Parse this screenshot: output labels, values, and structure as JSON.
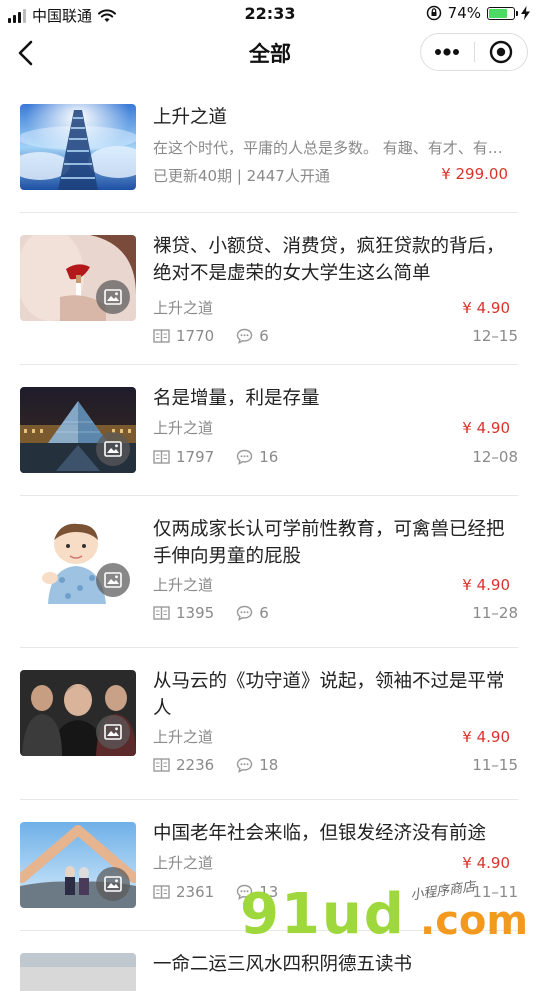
{
  "status_bar": {
    "carrier": "中国联通",
    "time": "22:33",
    "battery": "74%",
    "battery_level": 0.74
  },
  "nav": {
    "title": "全部",
    "more_icon": "more-dots-icon",
    "close_icon": "target-circle-icon"
  },
  "featured": {
    "title": "上升之道",
    "description": "在这个时代，平庸的人总是多数。 有趣、有才、有…",
    "meta": "已更新40期 | 2447人开通",
    "price": "¥ 299.00"
  },
  "articles": [
    {
      "title": "裸贷、小额贷、消费贷，疯狂贷款的背后，绝对不是虚荣的女大学生这么简单",
      "column": "上升之道",
      "price": "¥ 4.90",
      "reads": "1770",
      "comments": "6",
      "date": "12–15"
    },
    {
      "title": "名是增量，利是存量",
      "column": "上升之道",
      "price": "¥ 4.90",
      "reads": "1797",
      "comments": "16",
      "date": "12–08"
    },
    {
      "title": "仅两成家长认可学前性教育，可禽兽已经把手伸向男童的屁股",
      "column": "上升之道",
      "price": "¥ 4.90",
      "reads": "1395",
      "comments": "6",
      "date": "11–28"
    },
    {
      "title": "从马云的《功守道》说起，领袖不过是平常人",
      "column": "上升之道",
      "price": "¥ 4.90",
      "reads": "2236",
      "comments": "18",
      "date": "11–15"
    },
    {
      "title": "中国老年社会来临，但银发经济没有前途",
      "column": "上升之道",
      "price": "¥ 4.90",
      "reads": "2361",
      "comments": "13",
      "date": "11–11"
    },
    {
      "title": "一命二运三风水四积阴德五读书"
    }
  ],
  "watermark": {
    "main": "91ud",
    "suffix": ".com",
    "signature": "小程序商店"
  },
  "colors": {
    "price": "#d9342b",
    "battery": "#4cd964",
    "watermark_green": "#9ed83c",
    "watermark_orange": "#f39a1e"
  }
}
